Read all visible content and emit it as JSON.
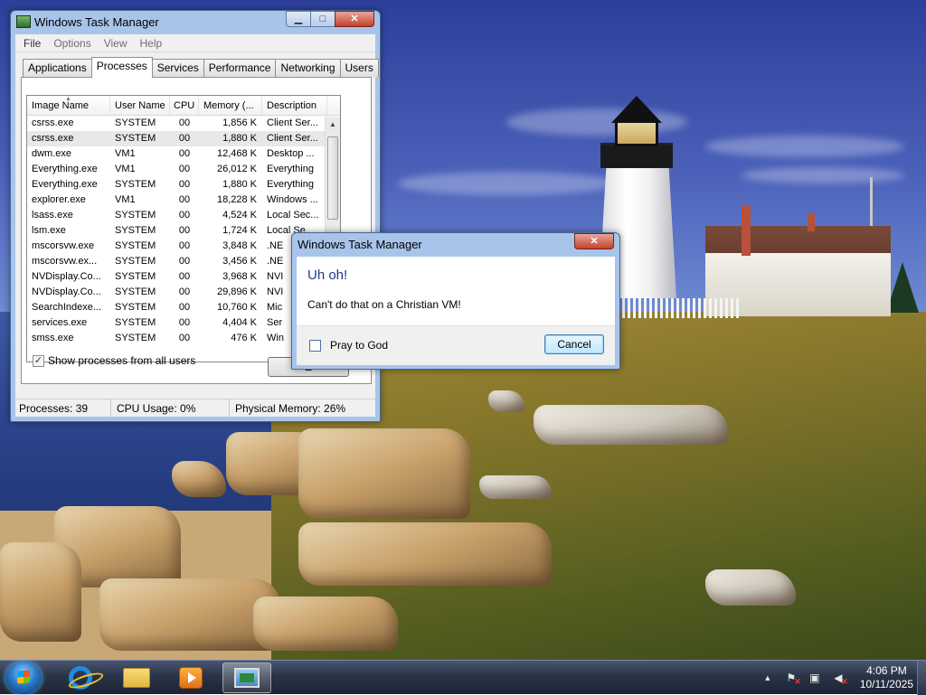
{
  "task_manager": {
    "title": "Windows Task Manager",
    "menu": [
      "File",
      "Options",
      "View",
      "Help"
    ],
    "tabs": [
      "Applications",
      "Processes",
      "Services",
      "Performance",
      "Networking",
      "Users"
    ],
    "active_tab": "Processes",
    "columns": [
      "Image Name",
      "User Name",
      "CPU",
      "Memory (...",
      "Description"
    ],
    "rows": [
      [
        "csrss.exe",
        "SYSTEM",
        "00",
        "1,856 K",
        "Client Ser..."
      ],
      [
        "csrss.exe",
        "SYSTEM",
        "00",
        "1,880 K",
        "Client Ser..."
      ],
      [
        "dwm.exe",
        "VM1",
        "00",
        "12,468 K",
        "Desktop ..."
      ],
      [
        "Everything.exe",
        "VM1",
        "00",
        "26,012 K",
        "Everything"
      ],
      [
        "Everything.exe",
        "SYSTEM",
        "00",
        "1,880 K",
        "Everything"
      ],
      [
        "explorer.exe",
        "VM1",
        "00",
        "18,228 K",
        "Windows ..."
      ],
      [
        "lsass.exe",
        "SYSTEM",
        "00",
        "4,524 K",
        "Local Sec..."
      ],
      [
        "lsm.exe",
        "SYSTEM",
        "00",
        "1,724 K",
        "Local Se..."
      ],
      [
        "mscorsvw.exe",
        "SYSTEM",
        "00",
        "3,848 K",
        ".NE"
      ],
      [
        "mscorsvw.ex...",
        "SYSTEM",
        "00",
        "3,456 K",
        ".NE"
      ],
      [
        "NVDisplay.Co...",
        "SYSTEM",
        "00",
        "3,968 K",
        "NVI"
      ],
      [
        "NVDisplay.Co...",
        "SYSTEM",
        "00",
        "29,896 K",
        "NVI"
      ],
      [
        "SearchIndexe...",
        "SYSTEM",
        "00",
        "10,760 K",
        "Mic"
      ],
      [
        "services.exe",
        "SYSTEM",
        "00",
        "4,404 K",
        "Ser"
      ],
      [
        "smss.exe",
        "SYSTEM",
        "00",
        "476 K",
        "Win"
      ]
    ],
    "show_all_label": "Show processes from all users",
    "show_all_checked": "✓",
    "end_button_label": "E",
    "status": {
      "processes": "Processes: 39",
      "cpu": "CPU Usage: 0%",
      "memory": "Physical Memory: 26%"
    }
  },
  "dialog": {
    "title": "Windows Task Manager",
    "heading": "Uh oh!",
    "message": "Can't do that on a Christian VM!",
    "checkbox_label": "Pray to God",
    "cancel_label": "Cancel"
  },
  "window_buttons": {
    "minimize": "▁",
    "maximize": "□",
    "close": "✕"
  },
  "taskbar": {
    "apps": [
      "internet-explorer-icon",
      "file-explorer-icon",
      "media-player-icon",
      "task-manager-icon"
    ],
    "tray_arrow": "▲",
    "time": "4:06 PM",
    "date": "10/11/2025"
  },
  "colors": {
    "dialog_heading": "#1e3a8a",
    "window_frame": "#a8c4ea",
    "close_button": "#c4422c"
  }
}
